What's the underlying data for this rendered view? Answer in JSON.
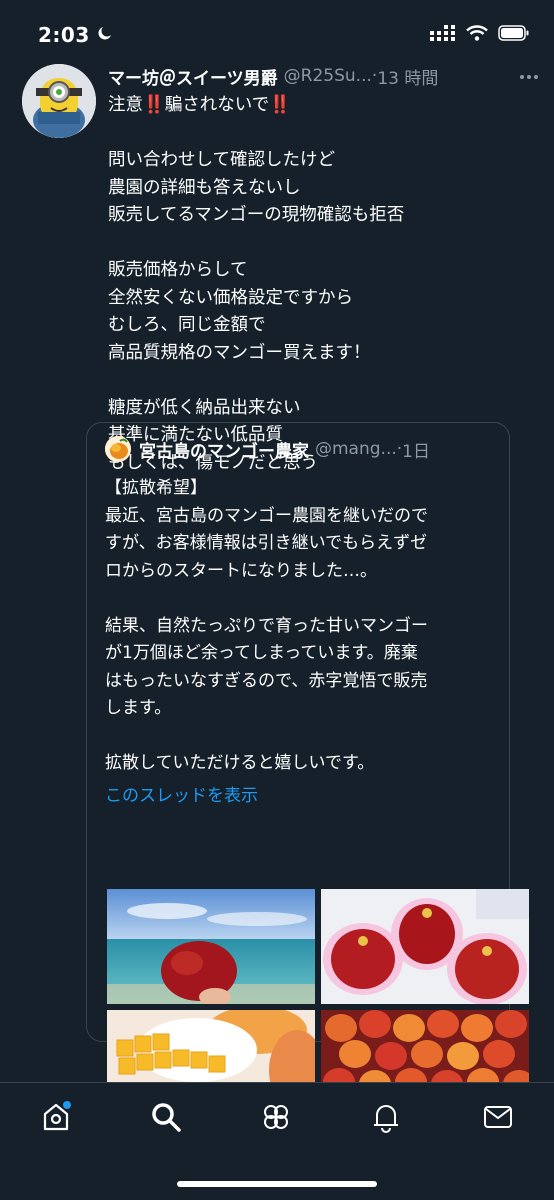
{
  "status_bar": {
    "time": "2:03"
  },
  "tweet": {
    "author_name": "マー坊＠スイーツ男爵",
    "handle": "@R25Su...",
    "separator": "·",
    "time": "13 時間",
    "text": "注意‼️騙されないで‼️\n\n問い合わせして確認したけど\n農園の詳細も答えないし\n販売してるマンゴーの現物確認も拒否\n\n販売価格からして\n全然安くない価格設定ですから\nむしろ、同じ金額で\n高品質規格のマンゴー買えます！\n\n糖度が低く納品出来ない\n基準に満たない低品質\nもしくは、傷モノだと思う"
  },
  "quote": {
    "author_name": "宮古島のマンゴー農家",
    "handle": "@mang...",
    "separator": "·",
    "time": "1日",
    "text": "【拡散希望】\n最近、宮古島のマンゴー農園を継いだので\nすが、お客様情報は引き継いでもらえずゼ\nロからのスタートになりました…。\n\n結果、自然たっぷりで育った甘いマンゴー\nが1万個ほど余ってしまっています。廃棄\nはもったいなすぎるので、赤字覚悟で販売\nします。\n\n拡散していただけると嬉しいです。",
    "thread_link": "このスレッドを表示"
  },
  "tab_bar": {
    "items": [
      "home-icon",
      "search-icon",
      "communities-icon",
      "notifications-icon",
      "messages-icon"
    ]
  },
  "colors": {
    "background": "#15202b",
    "secondary_text": "#8b98a5",
    "accent": "#1d9bf0",
    "border": "#38444d"
  }
}
